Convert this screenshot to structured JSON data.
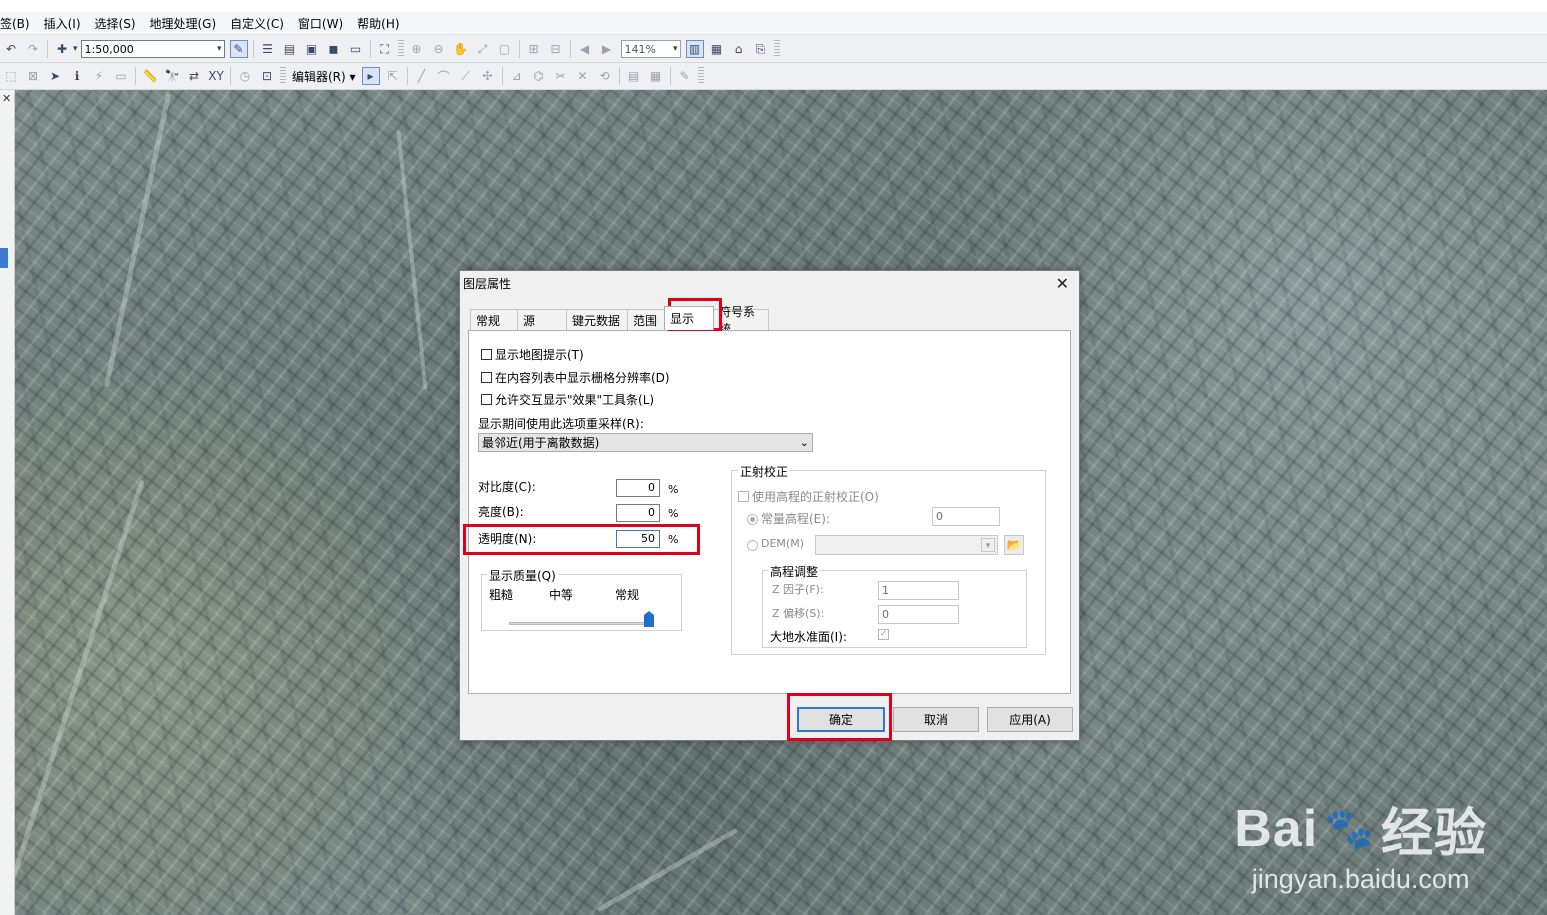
{
  "menubar": {
    "items": [
      "签(B)",
      "插入(I)",
      "选择(S)",
      "地理处理(G)",
      "自定义(C)",
      "窗口(W)",
      "帮助(H)"
    ]
  },
  "toolbar": {
    "scale": "1:50,000",
    "zoom_percent": "141%",
    "editor_menu": "编辑器(R)"
  },
  "dialog": {
    "title": "图层属性",
    "close_glyph": "✕",
    "tabs": [
      "常规",
      "源",
      "键元数据",
      "范围",
      "显示",
      "符号系统"
    ],
    "active_tab": "显示",
    "checkboxes": [
      "显示地图提示(T)",
      "在内容列表中显示栅格分辨率(D)",
      "允许交互显示\"效果\"工具条(L)"
    ],
    "resample_label": "显示期间使用此选项重采样(R):",
    "resample_value": "最邻近(用于离散数据)",
    "contrast_label": "对比度(C):",
    "contrast_value": "0",
    "brightness_label": "亮度(B):",
    "brightness_value": "0",
    "transparency_label": "透明度(N):",
    "transparency_value": "50",
    "percent": "%",
    "quality": {
      "title": "显示质量(Q)",
      "labels": [
        "粗糙",
        "中等",
        "常规"
      ],
      "level": 1.0
    },
    "ortho": {
      "title": "正射校正",
      "use_elevation": "使用高程的正射校正(O)",
      "constant_elevation": "常量高程(E):",
      "constant_value": "0",
      "dem": "DEM(M)",
      "adjust_title": "高程调整",
      "z_factor_label": "Z 因子(F):",
      "z_factor_value": "1",
      "z_offset_label": "Z 偏移(S):",
      "z_offset_value": "0",
      "geoid_label": "大地水准面(I):"
    },
    "buttons": {
      "ok": "确定",
      "cancel": "取消",
      "apply": "应用(A)"
    }
  },
  "watermark": {
    "logo_text": "Bai",
    "logo_suffix": "经验",
    "url": "jingyan.baidu.com"
  },
  "colors": {
    "highlight": "#e0001a",
    "accent": "#2b78d6"
  }
}
